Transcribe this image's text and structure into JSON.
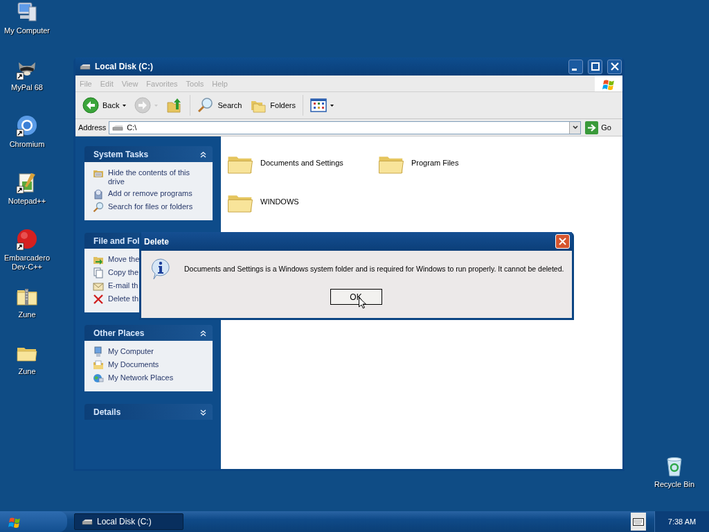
{
  "desktop_icons": [
    {
      "label": "My Computer",
      "kind": "computer",
      "shortcut": false
    },
    {
      "label": "MyPal 68",
      "kind": "animal",
      "shortcut": true
    },
    {
      "label": "Chromium",
      "kind": "ring",
      "shortcut": true
    },
    {
      "label": "Notepad++",
      "kind": "notepad",
      "shortcut": true
    },
    {
      "label": "Embarcadero Dev-C++",
      "kind": "disc",
      "shortcut": true
    },
    {
      "label": "Zune",
      "kind": "zip-folder",
      "shortcut": false
    },
    {
      "label": "Zune",
      "kind": "folder",
      "shortcut": false
    },
    {
      "label": "Recycle Bin",
      "kind": "recycle",
      "shortcut": false
    }
  ],
  "window": {
    "title": "Local Disk (C:)",
    "menu": [
      {
        "label": "File",
        "disabled": true
      },
      {
        "label": "Edit",
        "disabled": true
      },
      {
        "label": "View",
        "disabled": true
      },
      {
        "label": "Favorites",
        "disabled": true
      },
      {
        "label": "Tools",
        "disabled": true
      },
      {
        "label": "Help",
        "disabled": true
      }
    ],
    "toolbar": [
      {
        "kind": "back",
        "label": "Back",
        "disabled": false,
        "dropdown": true
      },
      {
        "kind": "forward",
        "disabled": true,
        "dropdown": true
      },
      {
        "kind": "up",
        "disabled": false,
        "dropdown": false
      },
      {
        "kind": "search",
        "label": "Search",
        "disabled": false,
        "dropdown": false
      },
      {
        "kind": "folders",
        "label": "Folders",
        "disabled": false,
        "dropdown": false
      },
      {
        "kind": "views",
        "disabled": false,
        "dropdown": true
      }
    ],
    "address": {
      "label": "Address",
      "value": "C:\\",
      "go": "Go"
    },
    "task_panels": [
      {
        "title": "System Tasks",
        "expanded": true,
        "toggle": true,
        "items": [
          {
            "kind": "hide",
            "label": "Hide the contents of this drive"
          },
          {
            "kind": "add-remove",
            "label": "Add or remove programs"
          },
          {
            "kind": "search",
            "label": "Search for files or folders"
          }
        ]
      },
      {
        "title": "File and Fol",
        "expanded": true,
        "items": [
          {
            "kind": "move",
            "label": "Move the"
          },
          {
            "kind": "copy",
            "label": "Copy the"
          },
          {
            "kind": "email",
            "label": "E-mail th"
          },
          {
            "kind": "delete",
            "label": "Delete th"
          }
        ]
      },
      {
        "title": "Other Places",
        "expanded": true,
        "toggle": true,
        "items": [
          {
            "kind": "computer",
            "label": "My Computer"
          },
          {
            "kind": "documents",
            "label": "My Documents"
          },
          {
            "kind": "network",
            "label": "My Network Places"
          }
        ]
      },
      {
        "title": "Details",
        "expanded": false,
        "toggle": true
      }
    ],
    "files": [
      {
        "name": "Documents and Settings"
      },
      {
        "name": "Program Files"
      },
      {
        "name": "WINDOWS"
      }
    ]
  },
  "dialog": {
    "title": "Delete",
    "message": "Documents and Settings is a Windows system folder and is required for Windows to run properly. It cannot be deleted.",
    "button": "OK"
  },
  "taskbar": {
    "tasks": [
      {
        "label": "Local Disk (C:)",
        "selected": true
      }
    ],
    "clock": "7:38 AM"
  }
}
